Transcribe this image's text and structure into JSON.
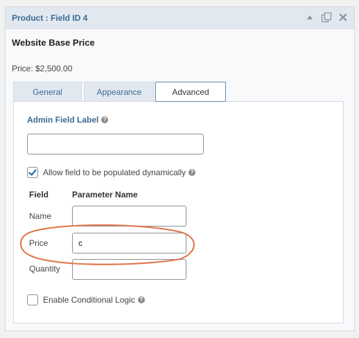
{
  "panel": {
    "title": "Product : Field ID 4",
    "heading": "Website Base Price",
    "price": "Price: $2,500.00"
  },
  "header_icons": [
    "collapse-icon",
    "duplicate-icon",
    "close-icon"
  ],
  "tabs": [
    {
      "label": "General",
      "active": false
    },
    {
      "label": "Appearance",
      "active": false
    },
    {
      "label": "Advanced",
      "active": true
    }
  ],
  "advanced": {
    "admin_label": "Admin Field Label",
    "admin_value": "",
    "allow_dynamic_label": "Allow field to be populated dynamically",
    "allow_dynamic_checked": true,
    "col_field": "Field",
    "col_param": "Parameter Name",
    "rows": [
      {
        "label": "Name",
        "value": ""
      },
      {
        "label": "Price",
        "value": "c"
      },
      {
        "label": "Quantity",
        "value": ""
      }
    ],
    "conditional_label": "Enable Conditional Logic",
    "conditional_checked": false
  },
  "colors": {
    "accent": "#3c6a93",
    "annotation": "#e07a4f",
    "checkbox_check": "#2271b1"
  }
}
